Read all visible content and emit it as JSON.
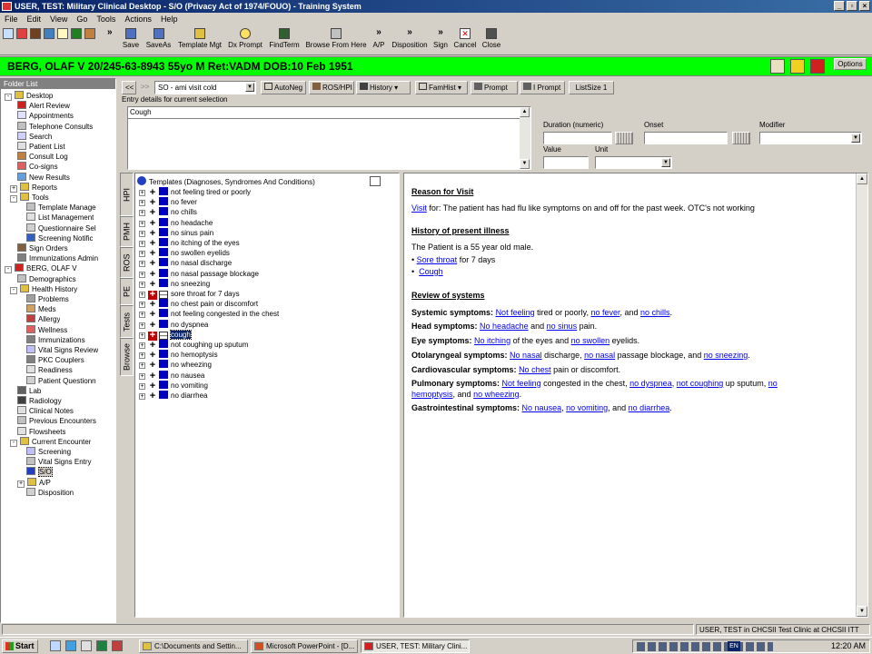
{
  "window": {
    "title": "USER, TEST: Military Clinical Desktop - S/O (Privacy Act of 1974/FOUO) - Training System",
    "controls": [
      "_",
      "▫",
      "×"
    ]
  },
  "menu": [
    "File",
    "Edit",
    "View",
    "Go",
    "Tools",
    "Actions",
    "Help"
  ],
  "toolbar": {
    "overflow": "»",
    "buttons": [
      "Save",
      "SaveAs",
      "Template Mgt",
      "Dx Prompt",
      "FindTerm",
      "Browse From Here",
      "A/P",
      "Disposition",
      "Sign",
      "Cancel",
      "Close"
    ]
  },
  "patient": {
    "banner": "BERG, OLAF V  20/245-63-8943  55yo  M   Ret:VADM  DOB:10 Feb 1951",
    "options_label": "Options"
  },
  "folder": {
    "header": "Folder List",
    "items": [
      "Desktop",
      "Alert Review",
      "Appointments",
      "Telephone Consults",
      "Search",
      "Patient List",
      "Consult Log",
      "Co-signs",
      "New Results",
      "Reports",
      "Tools",
      "Template Manage",
      "List Management",
      "Questionnaire Sel",
      "Screening Notific",
      "Sign Orders",
      "Immunizations Admin",
      "BERG, OLAF V",
      "Demographics",
      "Health History",
      "Problems",
      "Meds",
      "Allergy",
      "Wellness",
      "Immunizations",
      "Vital Signs Review",
      "PKC Couplers",
      "Readiness",
      "Patient Questionn",
      "Lab",
      "Radiology",
      "Clinical Notes",
      "Previous Encounters",
      "Flowsheets",
      "Current Encounter",
      "Screening",
      "Vital Signs Entry",
      "S/O",
      "A/P",
      "Disposition"
    ]
  },
  "nav": {
    "back": "<<",
    "fwd": ">>",
    "template_select": "SO - ami visit cold",
    "buttons": [
      "AutoNeg",
      "ROS/HPI",
      "History",
      "FamHist",
      "Prompt",
      "I Prompt",
      "ListSize 1"
    ]
  },
  "entry": {
    "label": "Entry details for current selection",
    "selected_term": "Cough",
    "duration_label": "Duration (numeric)",
    "onset_label": "Onset",
    "modifier_label": "Modifier",
    "value_label": "Value",
    "unit_label": "Unit"
  },
  "vtabs": [
    "HPI",
    "PMH",
    "ROS",
    "PE",
    "Tests",
    "Browse"
  ],
  "templates": {
    "root": "Templates (Diagnoses, Syndromes And Conditions)",
    "rows": [
      {
        "label": "not feeling tired or poorly",
        "state": "neg"
      },
      {
        "label": "no fever",
        "state": "neg"
      },
      {
        "label": "no chills",
        "state": "neg"
      },
      {
        "label": "no headache",
        "state": "neg"
      },
      {
        "label": "no sinus pain",
        "state": "neg"
      },
      {
        "label": "no itching of the eyes",
        "state": "neg"
      },
      {
        "label": "no swollen eyelids",
        "state": "neg"
      },
      {
        "label": "no nasal discharge",
        "state": "neg"
      },
      {
        "label": "no nasal passage blockage",
        "state": "neg"
      },
      {
        "label": "no sneezing",
        "state": "neg"
      },
      {
        "label": "sore throat for 7 days",
        "state": "pos"
      },
      {
        "label": "no chest pain or discomfort",
        "state": "neg"
      },
      {
        "label": "not feeling congested in the chest",
        "state": "neg"
      },
      {
        "label": "no dyspnea",
        "state": "neg"
      },
      {
        "label": "cough",
        "state": "pos-sel"
      },
      {
        "label": "not coughing up sputum",
        "state": "neg"
      },
      {
        "label": "no hemoptysis",
        "state": "neg"
      },
      {
        "label": "no wheezing",
        "state": "neg"
      },
      {
        "label": "no nausea",
        "state": "neg"
      },
      {
        "label": "no vomiting",
        "state": "neg"
      },
      {
        "label": "no diarrhea",
        "state": "neg"
      }
    ]
  },
  "note": {
    "rfv_heading": "Reason for Visit",
    "rfv_link": "Visit",
    "rfv_text": " for: The patient has had flu like symptoms on and off for the past week. OTC's not working",
    "hpi_heading": "History of present illness",
    "hpi_text": "The Patient is a 55 year old male.",
    "hpi_bullet1_link": "Sore throat",
    "hpi_bullet1_text": " for 7 days",
    "hpi_bullet2_link": "Cough",
    "ros_heading": "Review of systems",
    "systemic_label": "Systemic symptoms:",
    "systemic_l1": "Not feeling",
    "systemic_t1": " tired or poorly, ",
    "systemic_l2": "no fever",
    "systemic_t2": ", and ",
    "systemic_l3": "no chills",
    "head_label": "Head symptoms:",
    "head_l1": "No headache",
    "head_t1": " and ",
    "head_l2": "no sinus",
    "head_t2": " pain.",
    "eye_label": "Eye symptoms:",
    "eye_l1": "No itching",
    "eye_t1": " of the eyes and ",
    "eye_l2": "no swollen",
    "eye_t2": " eyelids.",
    "oto_label": "Otolaryngeal symptoms:",
    "oto_l1": "No nasal",
    "oto_t1": " discharge, ",
    "oto_l2": "no nasal",
    "oto_t2": " passage blockage, and ",
    "oto_l3": "no sneezing",
    "cardio_label": "Cardiovascular symptoms:",
    "cardio_l1": "No chest",
    "cardio_t1": " pain or discomfort.",
    "pulm_label": "Pulmonary symptoms:",
    "pulm_l1": "Not feeling",
    "pulm_t1": " congested in the chest, ",
    "pulm_l2": "no dyspnea",
    "pulm_t2": ", ",
    "pulm_l3": "not coughing",
    "pulm_t3": " up sputum, ",
    "pulm_l4": "no",
    "pulm_l5": "hemoptysis",
    "pulm_t5": ", and ",
    "pulm_l6": "no wheezing",
    "gi_label": "Gastrointestinal symptoms:",
    "gi_l1": "No nausea",
    "gi_t1": ", ",
    "gi_l2": "no vomiting",
    "gi_t2": ", and ",
    "gi_l3": "no diarrhea"
  },
  "status": {
    "text": "USER, TEST in CHCSII Test Clinic at CHCSII ITT"
  },
  "taskbar": {
    "start": "Start",
    "tasks": [
      "C:\\Documents and Settin...",
      "Microsoft PowerPoint - [D...",
      "USER, TEST: Military Clini..."
    ],
    "clock": "12:20 AM",
    "lang": "EN"
  }
}
